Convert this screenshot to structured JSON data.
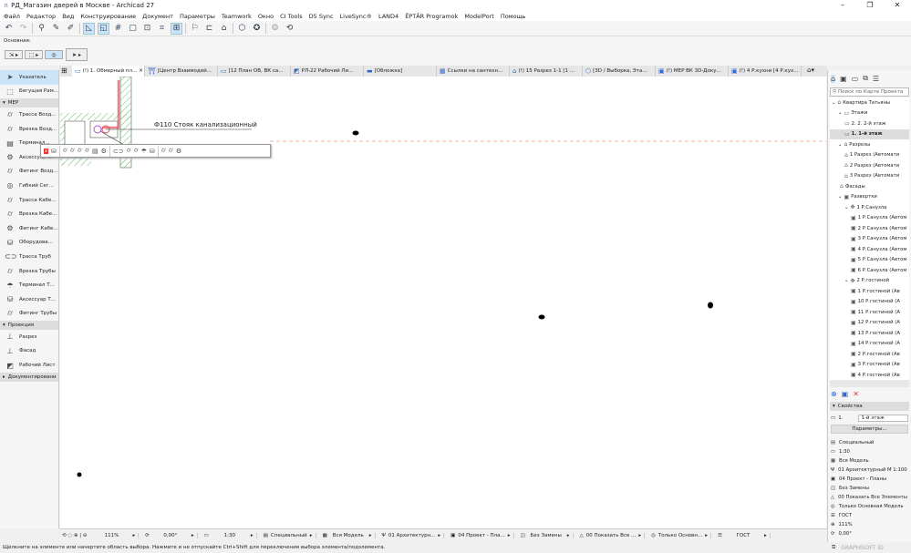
{
  "title": "РД_Магазин дверей в Москве - Archicad 27",
  "menu": [
    "Файл",
    "Редактор",
    "Вид",
    "Конструирование",
    "Документ",
    "Параметры",
    "Teamwork",
    "Окно",
    "CI Tools",
    "D5 Sync",
    "LiveSync®",
    "LAND4",
    "ĒPTĀR Programok",
    "ModelPort",
    "Помощь"
  ],
  "infobox_label": "Основная:",
  "tabs": [
    "(!) 1. Обмерный пл...",
    "[Центр Взаимодей...",
    "[12 План ОВ, ВК са...",
    "РЛ-22 Рабочий Ли...",
    "[Обложка]",
    "Ссылки на сантехн...",
    "(!) 15 Разрез 1-1 [1 ...",
    "[3D / Выборка, Эта...",
    "(!) МЕР ВК 3D-Доку...",
    "(!) 4 Р.кухни [4 Р.кух..."
  ],
  "left_panel": {
    "top": [
      "Указатель",
      "Бегущая Рам..."
    ],
    "mep_header": "МЕР",
    "mep": [
      "Трасса Возд...",
      "Врезка Возд...",
      "Терминал...",
      "Аксессуар В...",
      "Фитинг Возд...",
      "Гибкий Сег...",
      "Трасса Кабе...",
      "Врезка Кабе...",
      "Фитинг Кабе...",
      "Оборудова...",
      "Трасса Труб",
      "Врезка Трубы",
      "Терминал Т...",
      "Аксессуар Т...",
      "Фитинг Трубы"
    ],
    "proj_header": "Проекция",
    "proj": [
      "Разрез",
      "Фасад",
      "Рабочий Лист"
    ],
    "doc_header": "Документировани"
  },
  "canvas": {
    "label": "Ф110 Стояк канализационный"
  },
  "navigator": {
    "search_placeholder": "Поиск по Карте Проекта",
    "tree": [
      {
        "label": "Квартира Татьяны",
        "level": 0,
        "icon": "⌂"
      },
      {
        "label": "Этажи",
        "level": 1,
        "icon": "▭"
      },
      {
        "label": "2. 2. 2-й этаж",
        "level": 2,
        "icon": "▭"
      },
      {
        "label": "1. 1-й этаж",
        "level": 2,
        "icon": "▭",
        "selected": true
      },
      {
        "label": "Разрезы",
        "level": 1,
        "icon": "⌂"
      },
      {
        "label": "1 Разрез (Автомати",
        "level": 2,
        "icon": "⌂"
      },
      {
        "label": "2 Разрез (Автомати",
        "level": 2,
        "icon": "⌂"
      },
      {
        "label": "3 Разрез (Автомати",
        "level": 2,
        "icon": "⌂"
      },
      {
        "label": "Фасады",
        "level": 1,
        "icon": "⌂"
      },
      {
        "label": "Развертки",
        "level": 1,
        "icon": "▣"
      },
      {
        "label": "1 Р.Санузла",
        "level": 2,
        "icon": "✥"
      },
      {
        "label": "1 Р.Санузла (Автом",
        "level": 3,
        "icon": "▣"
      },
      {
        "label": "2 Р.Санузла (Автом",
        "level": 3,
        "icon": "▣"
      },
      {
        "label": "3 Р.Санузла (Автом",
        "level": 3,
        "icon": "▣"
      },
      {
        "label": "4 Р.Санузла (Автом",
        "level": 3,
        "icon": "▣"
      },
      {
        "label": "5 Р.Санузла (Автом",
        "level": 3,
        "icon": "▣"
      },
      {
        "label": "6 Р.Санузла (Автом",
        "level": 3,
        "icon": "▣"
      },
      {
        "label": "2 Р.гостиной",
        "level": 2,
        "icon": "✥"
      },
      {
        "label": "1 Р.гостиной (Ав",
        "level": 3,
        "icon": "▣"
      },
      {
        "label": "10 Р.гостиной (А",
        "level": 3,
        "icon": "▣"
      },
      {
        "label": "11 Р.гостиной (А",
        "level": 3,
        "icon": "▣"
      },
      {
        "label": "12 Р.гостиной (А",
        "level": 3,
        "icon": "▣"
      },
      {
        "label": "13 Р.гостиной (А",
        "level": 3,
        "icon": "▣"
      },
      {
        "label": "14 Р.гостиной (А",
        "level": 3,
        "icon": "▣"
      },
      {
        "label": "2 Р.гостиной (Ав",
        "level": 3,
        "icon": "▣"
      },
      {
        "label": "3 Р.гостиной (Ав",
        "level": 3,
        "icon": "▣"
      },
      {
        "label": "4 Р.гостиной (Ав",
        "level": 3,
        "icon": "▣"
      }
    ],
    "props_header": "Свойства",
    "prop_id": "1.",
    "prop_name": "1-й этаж",
    "params_button": "Параметры...",
    "props": [
      {
        "icon": "▤",
        "label": "Специальный"
      },
      {
        "icon": "▭",
        "label": "1:30"
      },
      {
        "icon": "▦",
        "label": "Вся Модель"
      },
      {
        "icon": "Ψ",
        "label": "01 Архитектурный М 1:100"
      },
      {
        "icon": "▣",
        "label": "04 Проект - Планы"
      },
      {
        "icon": "◫",
        "label": "Без Замены"
      },
      {
        "icon": "△",
        "label": "00 Показать Все Элементы"
      },
      {
        "icon": "◎",
        "label": "Только Основная Модель"
      },
      {
        "icon": "☰",
        "label": "ГОСТ"
      },
      {
        "icon": "⊕",
        "label": "111%"
      },
      {
        "icon": "⟳",
        "label": "0,00°"
      }
    ]
  },
  "statusbar": [
    "111%",
    "0,00°",
    "1:30",
    "Специальный",
    "Вся Модель",
    "01 Архитектурн...",
    "04 Проект - Пла...",
    "Без Замены",
    "00 Показать Все ...",
    "Только Основн...",
    "ГОСТ"
  ],
  "hint": "Щелкните на элементе или начертите область выбора. Нажмите и не отпускайте Ctrl+Shift для переключения выбора элемента/подэлемента.",
  "brand": "GRAPHISOFT ID",
  "colors": {
    "accent": "#cce4f7",
    "pipe": "#e05060",
    "dashed": "#f0a070"
  }
}
